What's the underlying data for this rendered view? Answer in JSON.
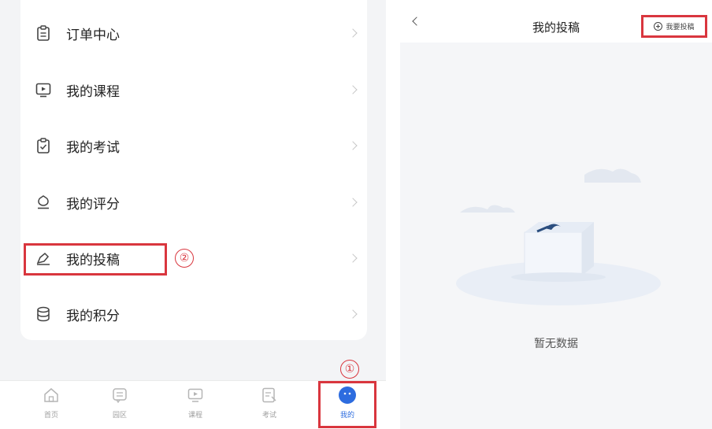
{
  "left": {
    "menu_items": [
      {
        "label": "订单中心",
        "icon": "order-clipboard-icon"
      },
      {
        "label": "我的课程",
        "icon": "course-screen-icon"
      },
      {
        "label": "我的考试",
        "icon": "exam-clipboard-icon"
      },
      {
        "label": "我的评分",
        "icon": "rating-flower-icon"
      },
      {
        "label": "我的投稿",
        "icon": "submission-pen-icon"
      },
      {
        "label": "我的积分",
        "icon": "points-database-icon"
      }
    ],
    "markers": {
      "step1": "①",
      "step2": "②"
    },
    "tabs": [
      {
        "label": "首页",
        "icon": "home-icon"
      },
      {
        "label": "园区",
        "icon": "community-icon"
      },
      {
        "label": "课程",
        "icon": "course-icon"
      },
      {
        "label": "考试",
        "icon": "exam-icon"
      },
      {
        "label": "我的",
        "icon": "profile-icon",
        "active": true
      }
    ]
  },
  "right": {
    "title": "我的投稿",
    "submit_label": "我要投稿",
    "empty_text": "暂无数据"
  },
  "colors": {
    "highlight": "#d9363e",
    "accent": "#2d6cdf",
    "page_bg": "#f3f4f6"
  }
}
